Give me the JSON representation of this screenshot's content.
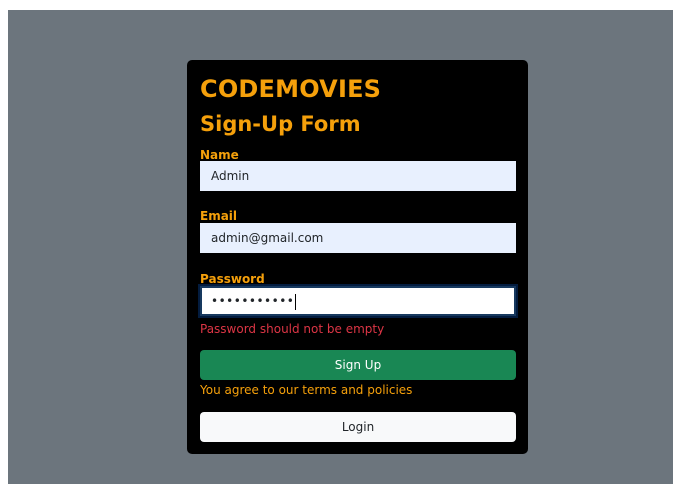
{
  "app": {
    "brand": "CODEMOVIES",
    "form_title": "Sign-Up Form"
  },
  "form": {
    "name": {
      "label": "Name",
      "value": "Admin"
    },
    "email": {
      "label": "Email",
      "value": "admin@gmail.com"
    },
    "password": {
      "label": "Password",
      "masked_value": "•••••••••••",
      "error": "Password should not be empty"
    },
    "signup_label": "Sign Up",
    "terms_text": "You agree to our terms and policies",
    "login_label": "Login"
  },
  "colors": {
    "background": "#6c757d",
    "card": "#000000",
    "accent": "#f5a00b",
    "error": "#dc3545",
    "success": "#198754",
    "input_bg": "#e8f0fe"
  }
}
